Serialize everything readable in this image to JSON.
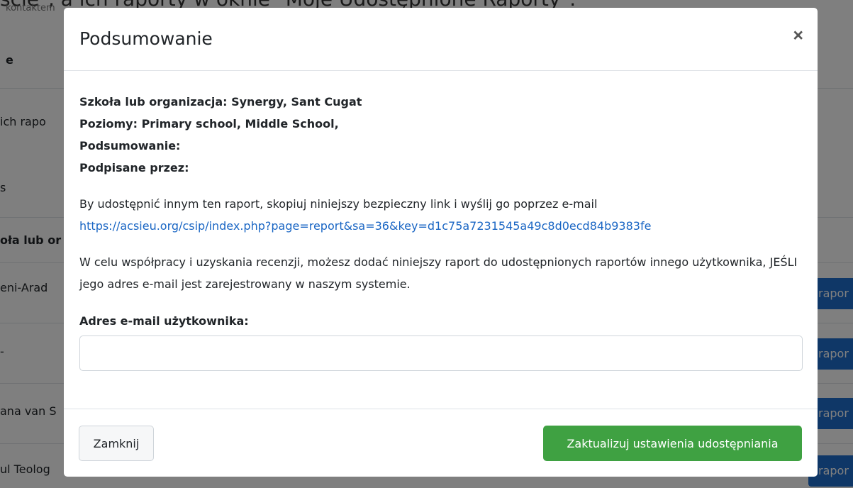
{
  "background": {
    "top_text": "ście\", a ich raporty w oknie \"Moje Udostępnione Raporty\".",
    "sub_text": "kontaktem",
    "fragments": [
      {
        "text": "e",
        "bold": true
      },
      {
        "text": "ich rapo",
        "bold": false
      },
      {
        "text": "s",
        "bold": false
      },
      {
        "text": "oła lub or",
        "bold": true
      },
      {
        "text": "eni-Arad",
        "bold": false
      },
      {
        "text": "-",
        "bold": false
      },
      {
        "text": "ana van S",
        "bold": false
      },
      {
        "text": "ul Teolog",
        "bold": false
      }
    ],
    "row_buttons": [
      "rapor",
      "rapor",
      "rapor",
      "rapor"
    ]
  },
  "modal": {
    "title": "Podsumowanie",
    "close_icon": "×",
    "info": {
      "school": "Szkoła lub organizacja: Synergy, Sant Cugat",
      "levels": "Poziomy: Primary school, Middle School,",
      "summary": "Podsumowanie:",
      "signed": "Podpisane przez:"
    },
    "share_text": "By udostępnić innym ten raport, skopiuj niniejszy bezpieczny link i wyślij go poprzez e-mail",
    "share_link": "https://acsieu.org/csip/index.php?page=report&sa=36&key=d1c75a7231545a49c8d0ecd84b9383fe",
    "collab_text": "W celu współpracy i uzyskania recenzji, możesz dodać niniejszy raport do udostępnionych raportów innego użytkownika, JEŚLI jego adres e-mail jest zarejestrowany w naszym systemie.",
    "email_label": "Adres e-mail użytkownika:",
    "email_value": "",
    "email_placeholder": "",
    "close_button": "Zamknij",
    "update_button": "Zaktualizuj ustawienia udostępniania"
  },
  "colors": {
    "primary_button": "#3fa142",
    "link": "#1a66c4",
    "background_button": "#1f6fcf"
  }
}
